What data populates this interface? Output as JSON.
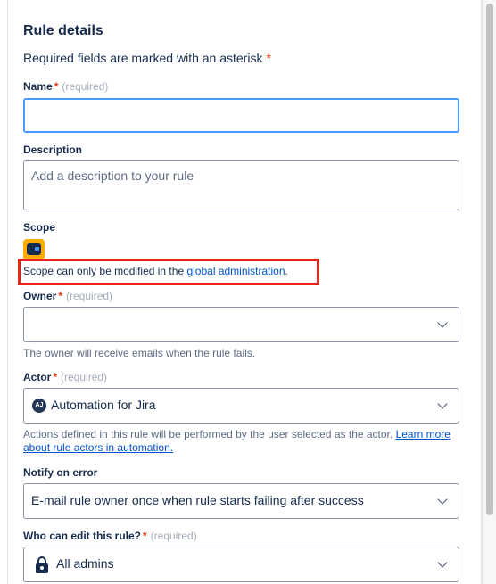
{
  "form": {
    "heading": "Rule details",
    "required_note": "Required fields are marked with an asterisk",
    "required_star": "*",
    "name": {
      "label": "Name",
      "star": "*",
      "hint": "(required)",
      "value": ""
    },
    "description": {
      "label": "Description",
      "placeholder": "Add a description to your rule"
    },
    "scope": {
      "label": "Scope",
      "icon": "project-icon",
      "note_prefix": "Scope can only be modified in the ",
      "note_link": "global administration",
      "note_suffix": "."
    },
    "owner": {
      "label": "Owner",
      "star": "*",
      "hint": "(required)",
      "value": "",
      "help": "The owner will receive emails when the rule fails."
    },
    "actor": {
      "label": "Actor",
      "star": "*",
      "hint": "(required)",
      "avatar_initials": "AJ",
      "value": "Automation for Jira",
      "help_prefix": "Actions defined in this rule will be performed by the user selected as the actor. ",
      "help_link": "Learn more about rule actors in automation."
    },
    "notify": {
      "label": "Notify on error",
      "value": "E-mail rule owner once when rule starts failing after success"
    },
    "editors": {
      "label": "Who can edit this rule?",
      "star": "*",
      "hint": "(required)",
      "value": "All admins"
    }
  },
  "colors": {
    "focus_border": "#4c9aff",
    "required_star": "#de350b",
    "link": "#0052cc",
    "highlight": "#e8241a"
  }
}
